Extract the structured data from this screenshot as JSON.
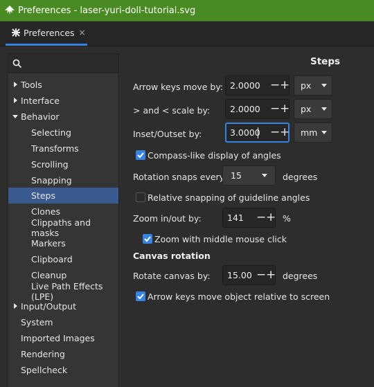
{
  "window": {
    "title": "Preferences - laser-yuri-doll-tutorial.svg"
  },
  "tab": {
    "label": "Preferences",
    "close": "×"
  },
  "sidebar": {
    "search_placeholder": "",
    "items": [
      {
        "label": "Tools",
        "expander": "collapsed"
      },
      {
        "label": "Interface",
        "expander": "collapsed"
      },
      {
        "label": "Behavior",
        "expander": "expanded"
      },
      {
        "label": "Selecting"
      },
      {
        "label": "Transforms"
      },
      {
        "label": "Scrolling"
      },
      {
        "label": "Snapping"
      },
      {
        "label": "Steps",
        "selected": true
      },
      {
        "label": "Clones"
      },
      {
        "label": "Clippaths and masks"
      },
      {
        "label": "Markers"
      },
      {
        "label": "Clipboard"
      },
      {
        "label": "Cleanup"
      },
      {
        "label": "Live Path Effects (LPE)"
      },
      {
        "label": "Input/Output",
        "expander": "collapsed"
      },
      {
        "label": "System"
      },
      {
        "label": "Imported Images"
      },
      {
        "label": "Rendering"
      },
      {
        "label": "Spellcheck"
      }
    ]
  },
  "main": {
    "title": "Steps",
    "arrow_keys": {
      "label": "Arrow keys move by:",
      "value": "2.0000",
      "unit": "px"
    },
    "scale": {
      "label": "> and < scale by:",
      "value": "2.0000",
      "unit": "px"
    },
    "inset": {
      "label": "Inset/Outset by:",
      "value": "3.0000",
      "unit": "mm"
    },
    "compass": {
      "label": "Compass-like display of angles",
      "checked": true
    },
    "rotation": {
      "label": "Rotation snaps every:",
      "value": "15",
      "suffix": "degrees"
    },
    "relative_snap": {
      "label": "Relative snapping of guideline angles",
      "checked": false
    },
    "zoom": {
      "label": "Zoom in/out by:",
      "value": "141",
      "suffix": "%"
    },
    "zoom_middle": {
      "label": "Zoom with middle mouse click",
      "checked": true
    },
    "canvas_rotation_title": "Canvas rotation",
    "rotate_canvas": {
      "label": "Rotate canvas by:",
      "value": "15.00",
      "suffix": "degrees"
    },
    "arrow_relative": {
      "label": "Arrow keys move object relative to screen",
      "checked": true
    },
    "minus": "−",
    "plus": "+"
  },
  "colors": {
    "titlebar": "#4a8a23",
    "accent": "#3584e4",
    "selection": "#3a5a8f"
  }
}
